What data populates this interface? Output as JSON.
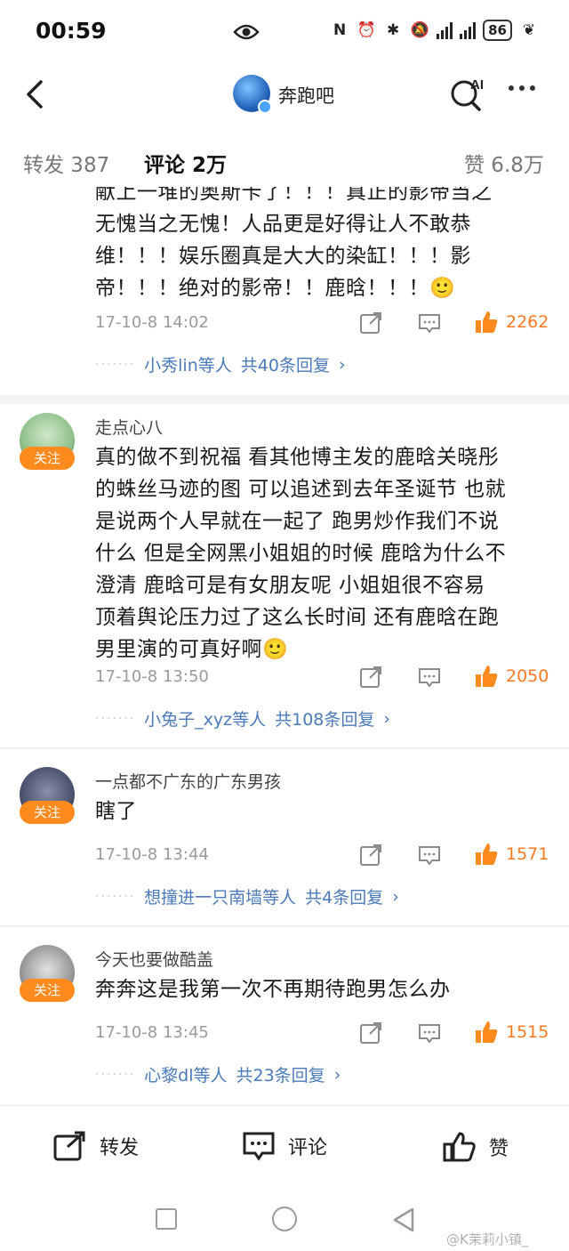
{
  "status_bar": {
    "time": "00:59",
    "battery": "86"
  },
  "header": {
    "account_name": "奔跑吧",
    "ai_label": "AI"
  },
  "tabs": [
    {
      "label": "转发 387"
    },
    {
      "label": "评论 2万"
    },
    {
      "label": "赞 6.8万"
    }
  ],
  "comments": [
    {
      "text_lines": [
        "献上一堆的奥斯卡了！！！真正的影帝当之",
        "无愧当之无愧！人品更是好得让人不敢恭",
        "维！！！娱乐圈真是大大的染缸！！！影",
        "帝！！！绝对的影帝！！鹿晗！！！🙂"
      ],
      "time": "17-10-8 14:02",
      "likes": "2262",
      "replies_who": "小秀lin等人",
      "replies_count": "共40条回复"
    },
    {
      "user": "走点心八",
      "follow": "关注",
      "text_lines": [
        "真的做不到祝福 看其他博主发的鹿晗关晓彤",
        "的蛛丝马迹的图 可以追述到去年圣诞节 也就",
        "是说两个人早就在一起了 跑男炒作我们不说",
        "什么 但是全网黑小姐姐的时候 鹿晗为什么不",
        "澄清 鹿晗可是有女朋友呢 小姐姐很不容易",
        "顶着舆论压力过了这么长时间 还有鹿晗在跑",
        "男里演的可真好啊🙂"
      ],
      "time": "17-10-8 13:50",
      "likes": "2050",
      "replies_who": "小兔子_xyz等人",
      "replies_count": "共108条回复"
    },
    {
      "user": "一点都不广东的广东男孩",
      "follow": "关注",
      "text_lines": [
        "瞎了"
      ],
      "time": "17-10-8 13:44",
      "likes": "1571",
      "replies_who": "想撞进一只南墙等人",
      "replies_count": "共4条回复"
    },
    {
      "user": "今天也要做酷盖",
      "follow": "关注",
      "text_lines": [
        "奔奔这是我第一次不再期待跑男怎么办"
      ],
      "time": "17-10-8 13:45",
      "likes": "1515",
      "replies_who": "心黎dl等人",
      "replies_count": "共23条回复"
    }
  ],
  "action_bar": {
    "repost": "转发",
    "comment": "评论",
    "like": "赞"
  },
  "watermark": "@K茉莉小镇_"
}
